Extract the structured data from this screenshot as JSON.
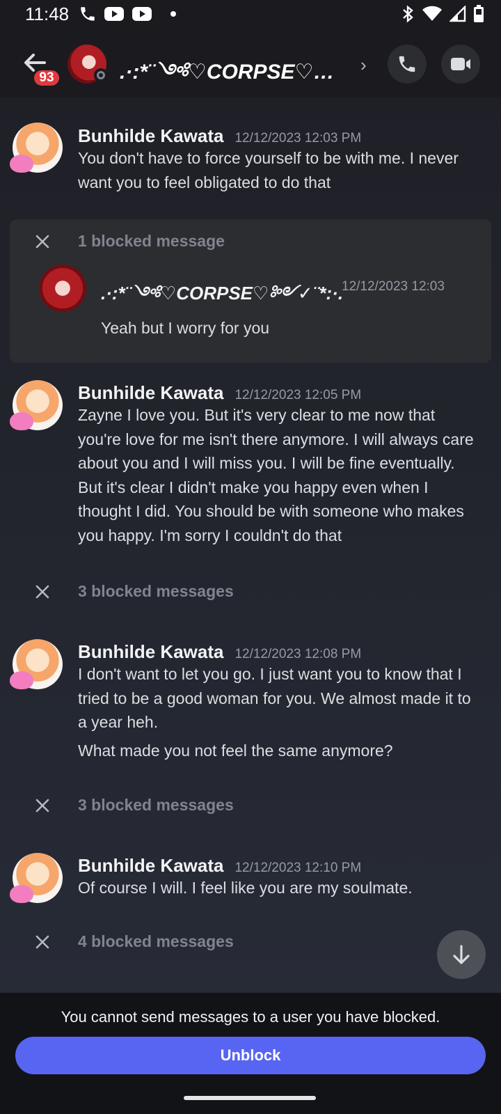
{
  "status_bar": {
    "time": "11:48"
  },
  "header": {
    "back_badge": "93",
    "title": ".·:*¨༺♡CORPSE♡…",
    "chevron": "›"
  },
  "messages": [
    {
      "author": "Bunhilde Kawata",
      "timestamp": "12/12/2023 12:03 PM",
      "text": "You don't have to force yourself to be with me. I never want you to feel obligated to do that"
    },
    {
      "author": "Bunhilde Kawata",
      "timestamp": "12/12/2023 12:05 PM",
      "text": "Zayne I love you. But it's very clear to me now that you're love for me isn't there anymore. I will always care about you and I will miss you. I will be fine eventually. But it's clear I didn't make you happy even when I thought I did. You should be with someone who makes you happy. I'm sorry I couldn't do that"
    },
    {
      "author": "Bunhilde Kawata",
      "timestamp": "12/12/2023 12:08 PM",
      "text": "I don't want to let you go. I just want you to know that I tried to be a good woman for you. We almost made it to a year heh.",
      "text2": "What made you not feel the same anymore?"
    },
    {
      "author": "Bunhilde Kawata",
      "timestamp": "12/12/2023 12:10 PM",
      "text": "Of course I will. I feel like you are my soulmate."
    }
  ],
  "blocked": [
    {
      "label": "1 blocked message",
      "author": ".·:*¨༺♡CORPSE♡༻✓¨*:·.",
      "timestamp": "12/12/2023 12:03",
      "text": "Yeah but I worry for you"
    },
    {
      "label": "3 blocked messages"
    },
    {
      "label": "3 blocked messages"
    },
    {
      "label": "4 blocked messages"
    }
  ],
  "footer": {
    "note": "You cannot send messages to a user you have blocked.",
    "unblock_label": "Unblock"
  },
  "icons": [
    "phone-icon",
    "youtube-icon",
    "bluetooth-icon",
    "wifi-icon",
    "signal-icon",
    "battery-icon",
    "back-arrow-icon",
    "call-icon",
    "video-icon",
    "close-icon",
    "arrow-down-icon"
  ],
  "colors": {
    "accent": "#5865f2",
    "badge": "#e0393e",
    "background": "#1f2027"
  }
}
